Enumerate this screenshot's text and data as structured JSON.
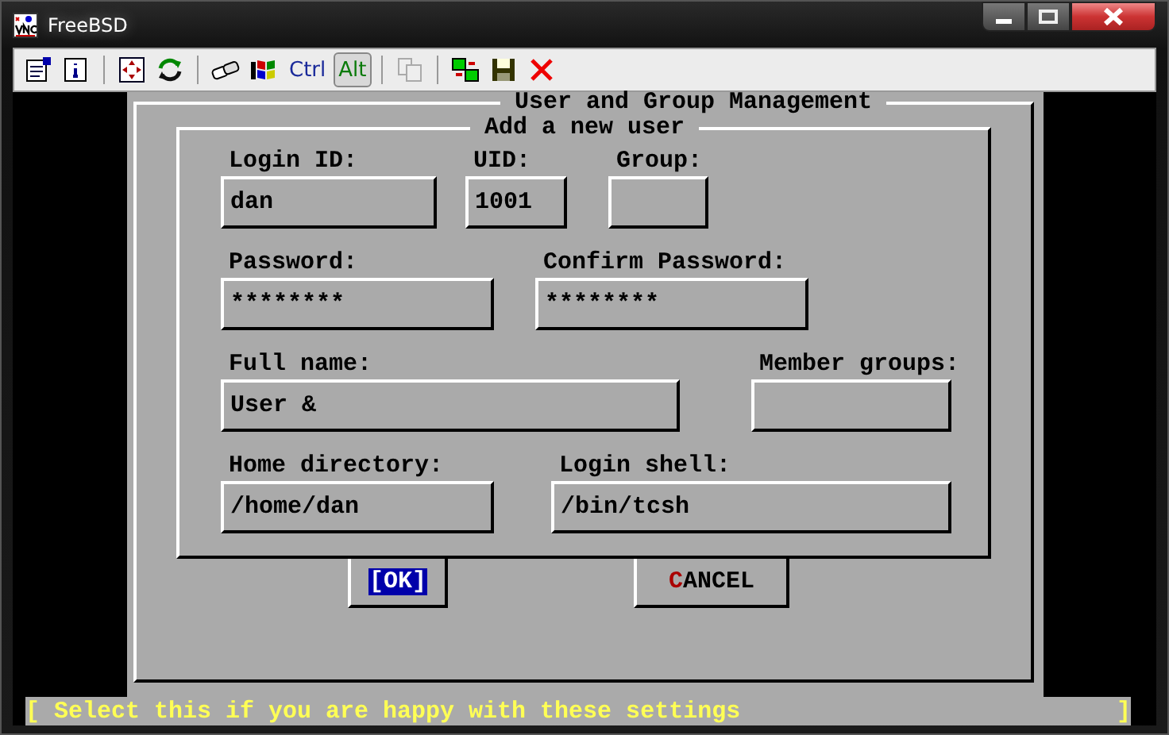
{
  "window": {
    "title": "FreeBSD"
  },
  "toolbar": [
    {
      "kind": "text",
      "label": "Ctrl",
      "selected": false
    },
    {
      "kind": "text",
      "label": "Alt",
      "selected": true
    }
  ],
  "dialog": {
    "title": "User and Group Management",
    "section_title": "Add a new user",
    "rows": [
      {
        "fields": [
          {
            "label": "Login ID:",
            "value": "dan"
          },
          {
            "label": "UID:",
            "value": "1001"
          },
          {
            "label": "Group:"
          }
        ]
      },
      {
        "fields": [
          {
            "label": "Password:",
            "value": "********"
          },
          {
            "label": "Confirm Password:",
            "value": "********"
          }
        ]
      },
      {
        "fields": [
          {
            "label": "Full name:",
            "value": "User &"
          },
          {
            "label": "Member groups:"
          }
        ]
      },
      {
        "fields": [
          {
            "label": "Home directory:",
            "value": "/home/dan"
          },
          {
            "label": "Login shell:",
            "value": "/bin/tcsh"
          }
        ]
      }
    ],
    "buttons": [
      {
        "label": "[OK]",
        "selected": true
      },
      {
        "label": "CANCEL",
        "selected": false
      }
    ]
  },
  "status_bar": {
    "text": "[ Select this if you are happy with these settings",
    "end": "]"
  }
}
